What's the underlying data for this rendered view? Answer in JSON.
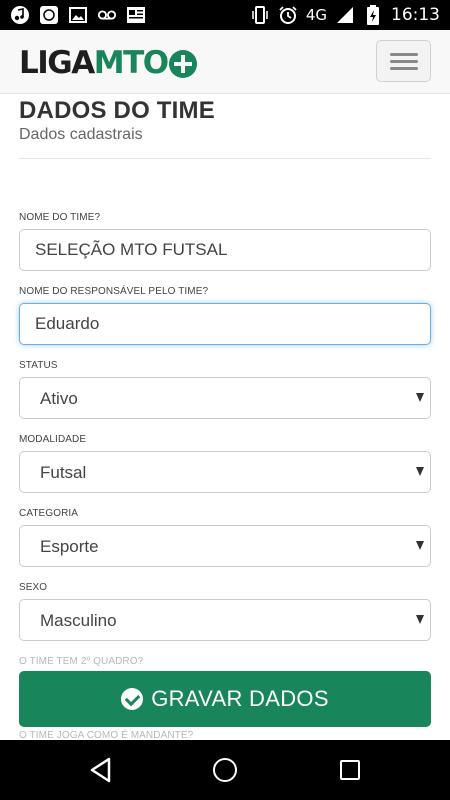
{
  "status_bar": {
    "network": "4G",
    "time": "16:13",
    "icons": [
      "music-icon",
      "app-icon",
      "image-icon",
      "voicemail-icon",
      "news-icon",
      "vibrate-icon",
      "alarm-icon",
      "signal-icon",
      "battery-charging-icon"
    ]
  },
  "header": {
    "logo_liga": "LIGA",
    "logo_mto": "MTO",
    "menu_icon": "hamburger-menu-icon"
  },
  "page": {
    "title": "DADOS DO TIME",
    "subtitle": "Dados cadastrais"
  },
  "form": {
    "team_name": {
      "label": "NOME DO TIME?",
      "value": "SELEÇÃO MTO FUTSAL"
    },
    "responsible": {
      "label": "NOME DO RESPONSÁVEL PELO TIME?",
      "value": "Eduardo"
    },
    "status": {
      "label": "STATUS",
      "value": "Ativo"
    },
    "modality": {
      "label": "MODALIDADE",
      "value": "Futsal"
    },
    "category": {
      "label": "CATEGORIA",
      "value": "Esporte"
    },
    "sex": {
      "label": "SEXO",
      "value": "Masculino"
    },
    "second_squad": {
      "label": "O TIME TEM 2º QUADRO?"
    },
    "home_team": {
      "label": "O TIME JOGA COMO É MANDANTE?"
    },
    "save_button": "GRAVAR DADOS"
  },
  "colors": {
    "brand_green": "#18855a",
    "focus_blue": "#66afe9"
  }
}
